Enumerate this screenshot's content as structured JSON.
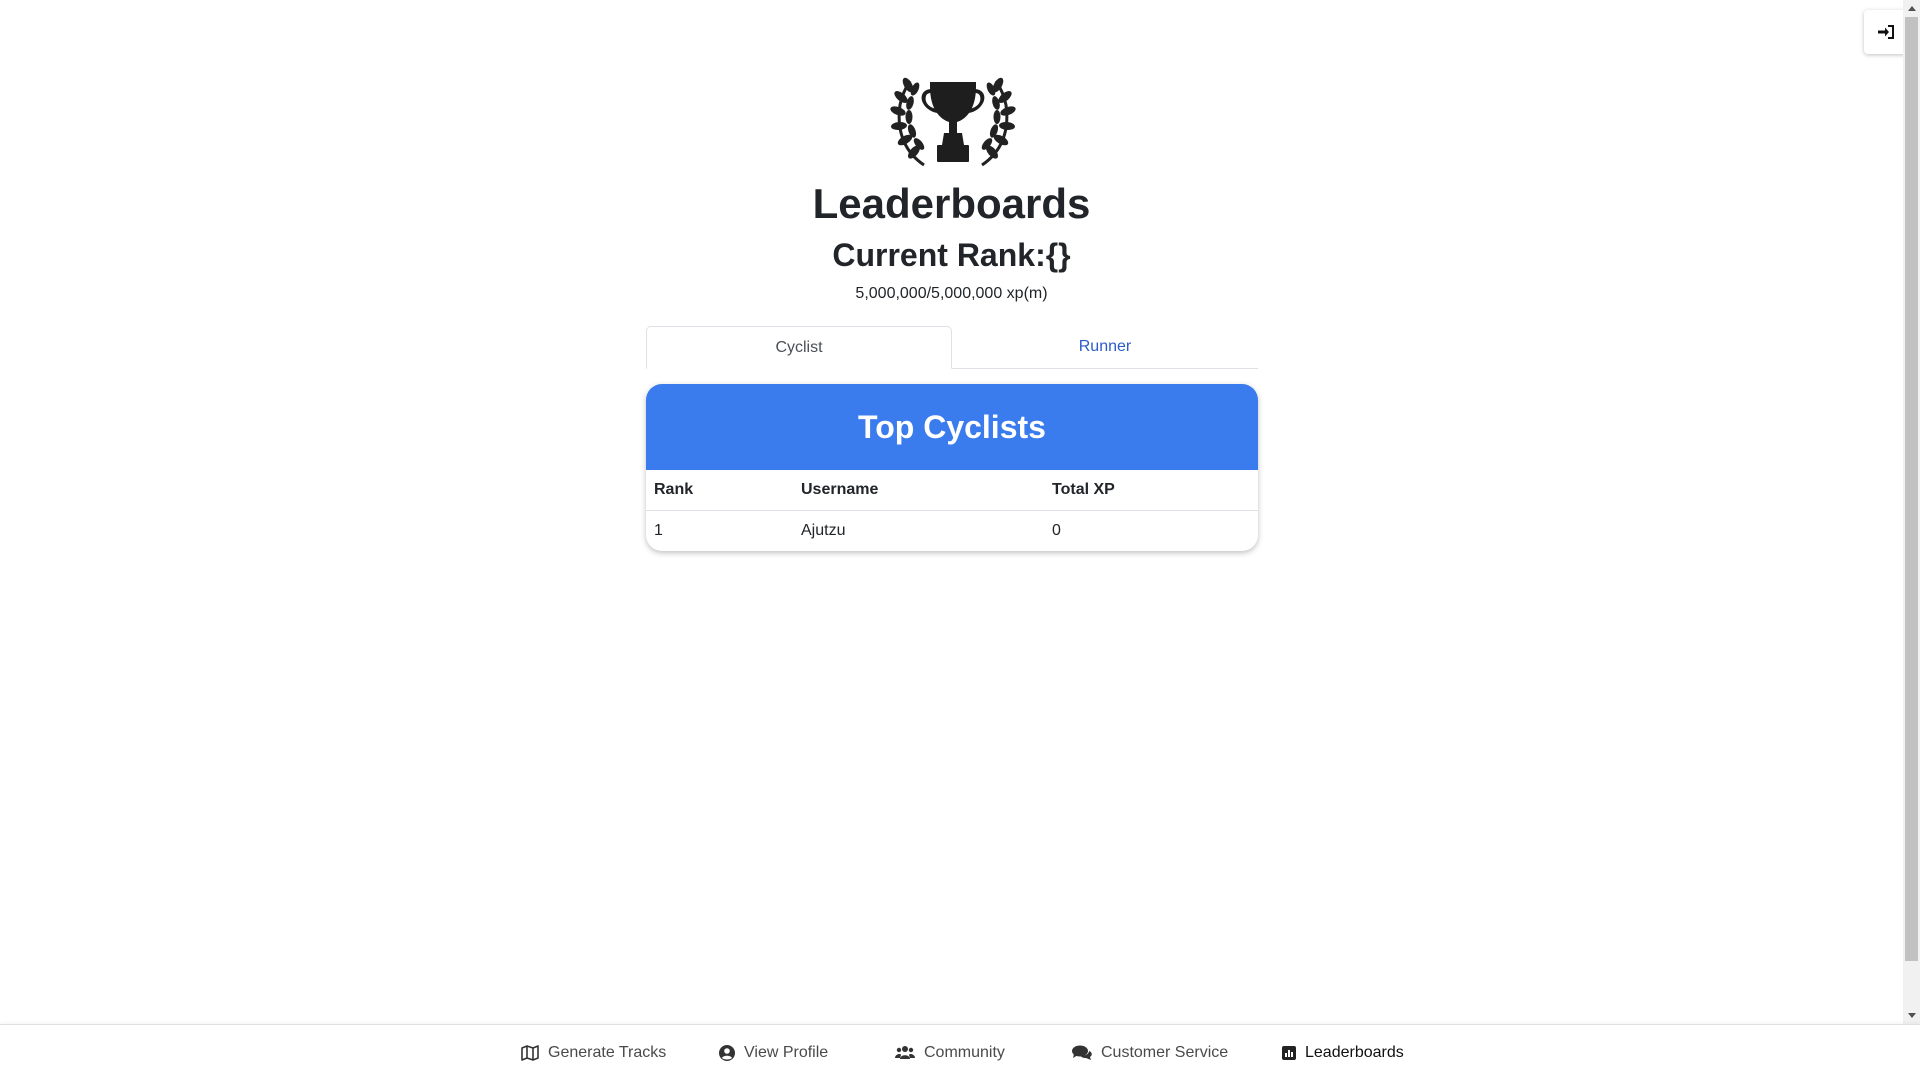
{
  "header": {
    "title": "Leaderboards",
    "current_rank": "Current Rank:{}",
    "xp_progress": "5,000,000/5,000,000 xp(m)"
  },
  "tabs": [
    {
      "label": "Cyclist",
      "active": true
    },
    {
      "label": "Runner",
      "active": false
    }
  ],
  "leaderboard": {
    "title": "Top Cyclists",
    "columns": [
      "Rank",
      "Username",
      "Total XP"
    ],
    "rows": [
      [
        "1",
        "Ajutzu",
        "0"
      ]
    ]
  },
  "footer_nav": [
    {
      "label": "Generate Tracks",
      "icon": "map-icon"
    },
    {
      "label": "View Profile",
      "icon": "user-circle-icon"
    },
    {
      "label": "Community",
      "icon": "users-icon"
    },
    {
      "label": "Customer Service",
      "icon": "comments-icon"
    },
    {
      "label": "Leaderboards",
      "icon": "chart-icon",
      "active": true
    }
  ],
  "top_right": {
    "icon": "sign-in-icon"
  },
  "colors": {
    "card_header": "#3a7bee",
    "tab_link": "#2b5cc9"
  }
}
